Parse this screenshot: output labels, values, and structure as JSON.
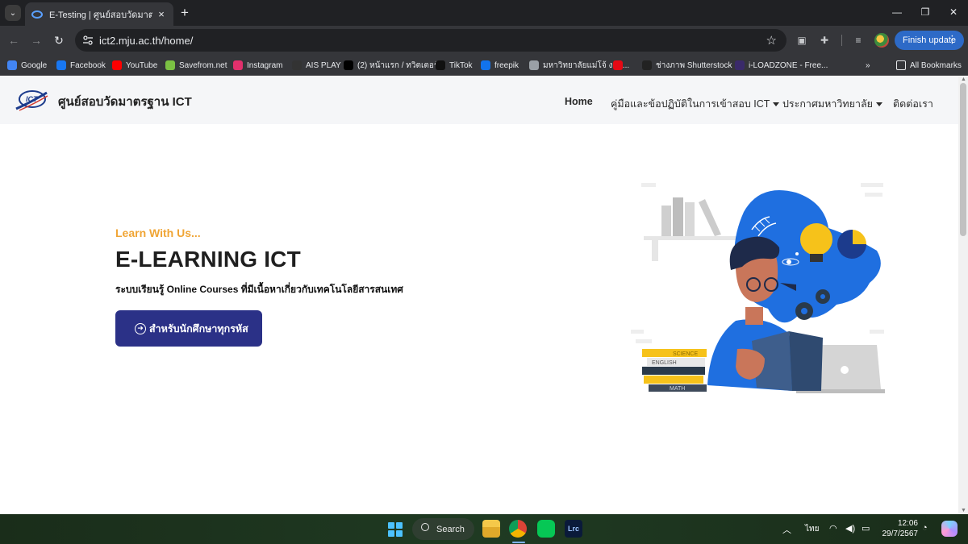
{
  "browser": {
    "tab_title": "E-Testing | ศูนย์สอบวัดมาตรฐาน IC",
    "url": "ict2.mju.ac.th/home/",
    "finish_update_label": "Finish update",
    "bookmarks": [
      {
        "label": "Google",
        "icon": "google-icon",
        "color": "#4285f4"
      },
      {
        "label": "Facebook",
        "icon": "facebook-icon",
        "color": "#1877f2"
      },
      {
        "label": "YouTube",
        "icon": "youtube-icon",
        "color": "#ff0000"
      },
      {
        "label": "Savefrom.net",
        "icon": "download-arrow-icon",
        "color": "#7bc043"
      },
      {
        "label": "Instagram",
        "icon": "instagram-icon",
        "color": "#e1306c"
      },
      {
        "label": "AIS PLAY",
        "icon": "ais-play-icon",
        "color": "#333333"
      },
      {
        "label": "(2) หน้าแรก / ทวิตเตอร์",
        "icon": "x-icon",
        "color": "#000000"
      },
      {
        "label": "TikTok",
        "icon": "tiktok-icon",
        "color": "#111111"
      },
      {
        "label": "freepik",
        "icon": "freepik-icon",
        "color": "#1273eb"
      },
      {
        "label": "มหาวิทยาลัยแม่โจ้ งาน...",
        "icon": "globe-icon",
        "color": "#9aa0a6"
      },
      {
        "label": "",
        "icon": "netflix-icon",
        "color": "#e50914"
      },
      {
        "label": "ช่างภาพ Shutterstock",
        "icon": "shutterstock-icon",
        "color": "#222222"
      },
      {
        "label": "i-LOADZONE - Free...",
        "icon": "iloadzone-icon",
        "color": "#3a2a6a"
      }
    ],
    "all_bookmarks_label": "All Bookmarks"
  },
  "site": {
    "brand": "ศูนย์สอบวัดมาตรฐาน ICT",
    "nav": [
      {
        "label": "Home",
        "has_caret": false
      },
      {
        "label": "คู่มือและข้อปฏิบัติในการเข้าสอบ ICT",
        "has_caret": true
      },
      {
        "label": "ประกาศมหาวิทยาลัย",
        "has_caret": true
      },
      {
        "label": "ติดต่อเรา",
        "has_caret": false
      }
    ],
    "hero": {
      "tagline": "Learn With Us...",
      "title": "E-LEARNING ICT",
      "subtitle": "ระบบเรียนรู้ Online Courses ที่มีเนื้อหาเกี่ยวกับเทคโนโลยีสารสนเทศ",
      "button_label": "สำหรับนักศึกษาทุกรหัส"
    },
    "illustration_books": [
      "SCIENCE",
      "ENGLISH",
      "MATH"
    ],
    "colors": {
      "accent": "#f0a535",
      "button": "#2b3187",
      "illustration_blue": "#1f6fe0"
    }
  },
  "taskbar": {
    "search_label": "Search",
    "language": "ไทย",
    "time": "12:06",
    "date": "29/7/2567"
  }
}
